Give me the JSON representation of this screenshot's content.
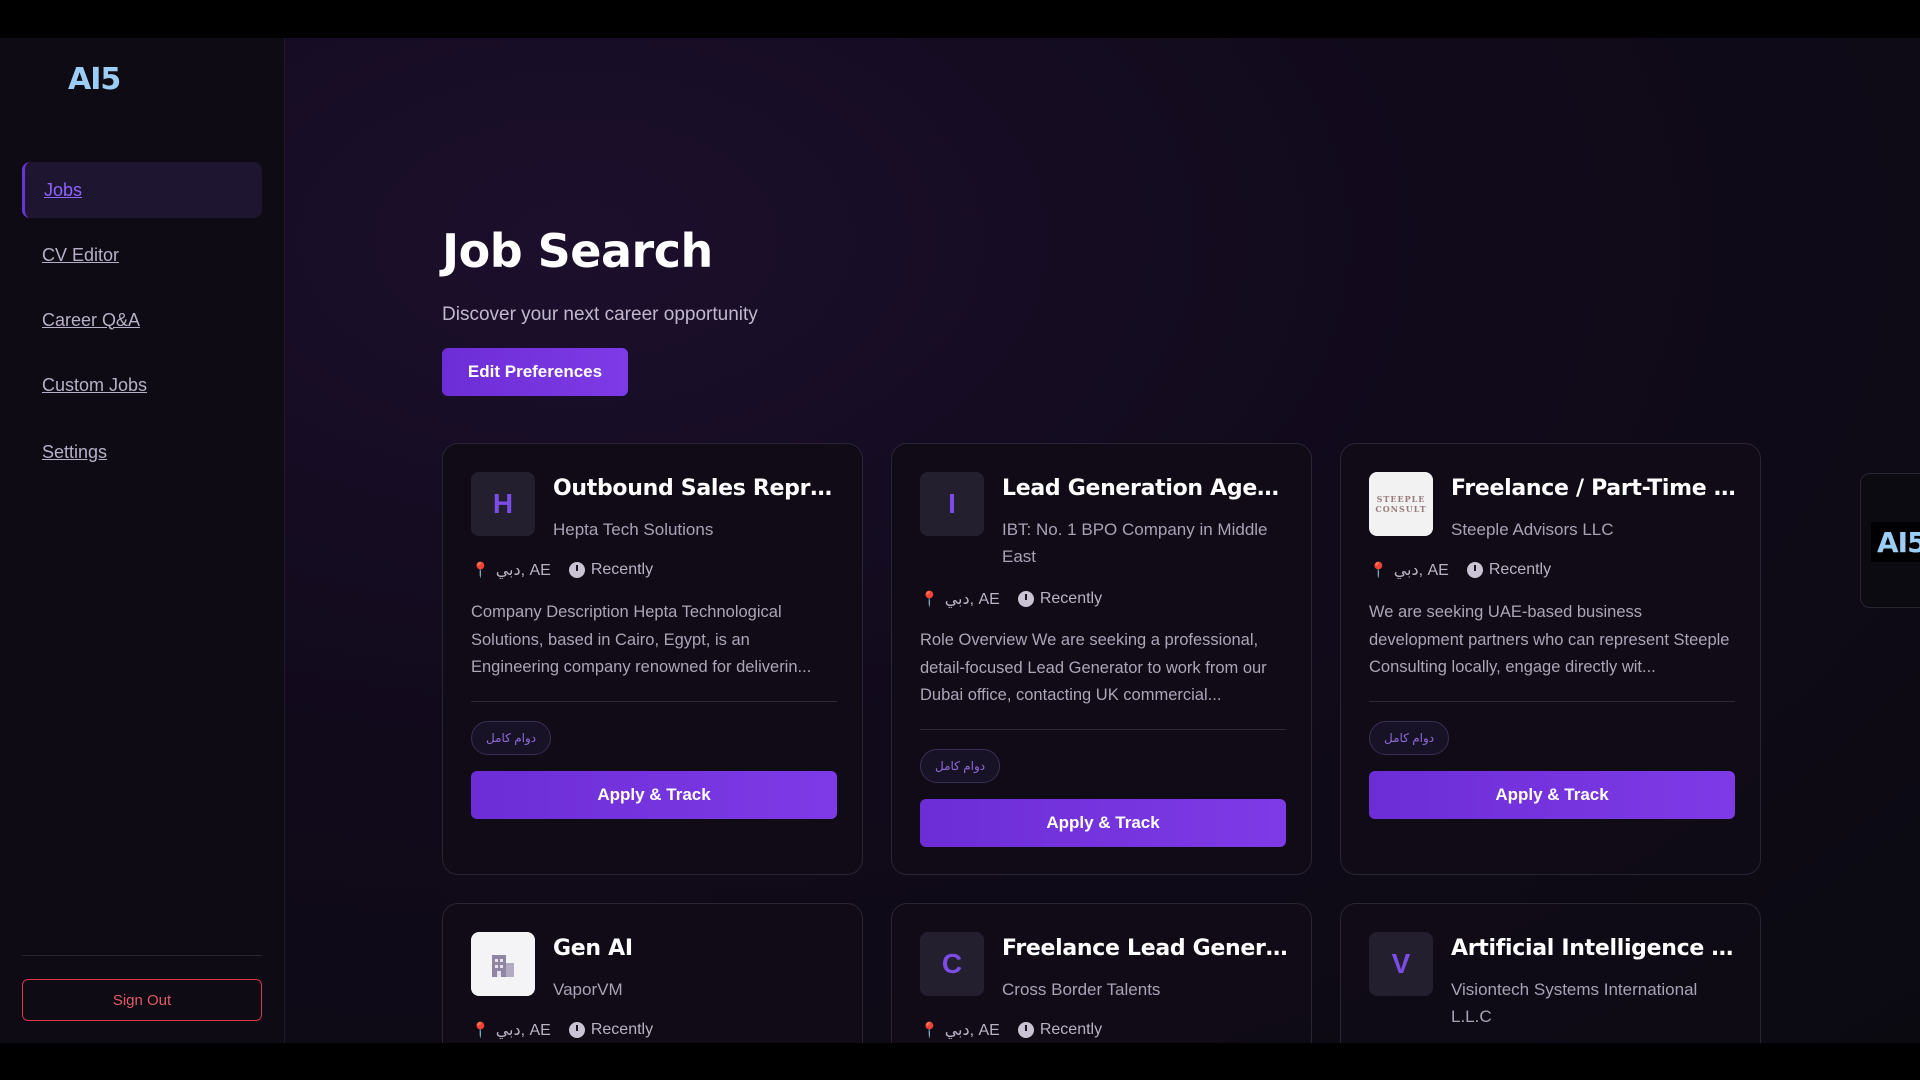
{
  "brand": {
    "logo_text": "AI5"
  },
  "sidebar": {
    "items": [
      {
        "label": "Jobs",
        "active": true
      },
      {
        "label": "CV Editor"
      },
      {
        "label": "Career Q&A"
      },
      {
        "label": "Custom Jobs"
      },
      {
        "label": "Settings"
      }
    ],
    "sign_out_label": "Sign Out"
  },
  "main": {
    "title": "Job Search",
    "subtitle": "Discover your next career opportunity",
    "edit_preferences_label": "Edit Preferences"
  },
  "jobs": [
    {
      "avatar": "H",
      "title": "Outbound Sales Represen...",
      "company": "Hepta Tech Solutions",
      "location": "دبي, AE",
      "posted": "Recently",
      "description": "Company Description Hepta Technological Solutions, based in Cairo, Egypt, is an Engineering company renowned for deliverin...",
      "tag": "دوام كامل",
      "apply_label": "Apply & Track"
    },
    {
      "avatar": "I",
      "title": "Lead Generation Agents",
      "company": "IBT: No. 1 BPO Company in Middle East",
      "location": "دبي, AE",
      "posted": "Recently",
      "description": "Role Overview We are seeking a professional, detail-focused Lead Generator to work from our Dubai office, contacting UK commercial...",
      "tag": "دوام كامل",
      "apply_label": "Apply & Track"
    },
    {
      "avatar": "STEEPLE CONSULT",
      "title": "Freelance / Part-Time Le...",
      "company": "Steeple Advisors LLC",
      "location": "دبي, AE",
      "posted": "Recently",
      "description": "We are seeking UAE-based business development partners who can represent Steeple Consulting locally, engage directly wit...",
      "tag": "دوام كامل",
      "apply_label": "Apply & Track"
    },
    {
      "avatar": "",
      "title": "Gen AI",
      "company": "VaporVM",
      "location": "دبي, AE",
      "posted": "Recently"
    },
    {
      "avatar": "C",
      "title": "Freelance Lead Generati...",
      "company": "Cross Border Talents",
      "location": "دبي, AE",
      "posted": "Recently"
    },
    {
      "avatar": "V",
      "title": "Artificial Intelligence - Le...",
      "company": "Visiontech Systems International L.L.C",
      "location": "",
      "posted": ""
    }
  ],
  "icons": {
    "location": "map-pin-icon",
    "time": "clock-icon",
    "company_placeholder": "building-icon"
  },
  "colors": {
    "accent": "#7330de",
    "danger": "#d63a4a",
    "pin": "#e8364c"
  }
}
